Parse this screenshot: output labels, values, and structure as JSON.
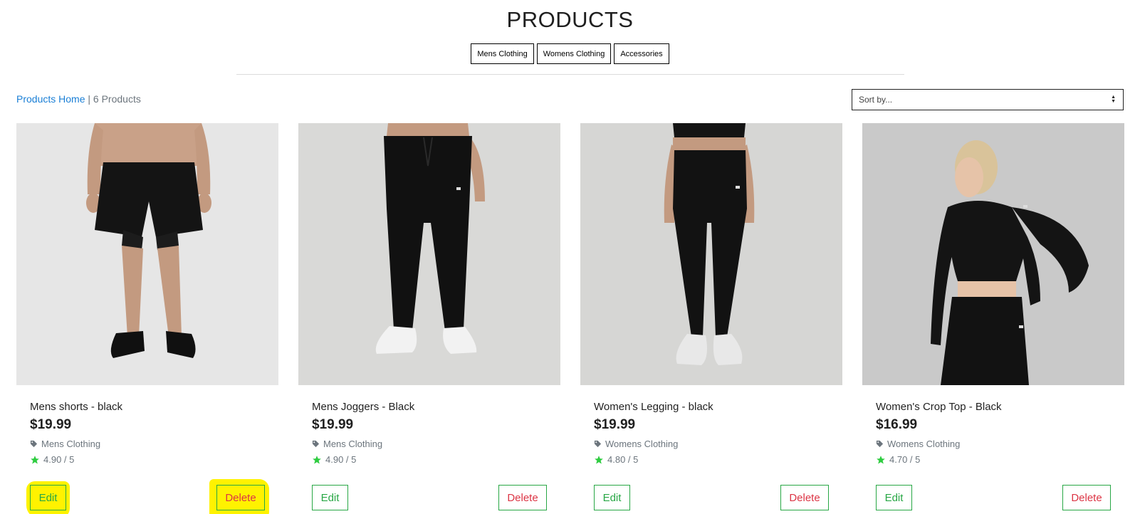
{
  "page": {
    "title": "PRODUCTS"
  },
  "category_nav": [
    {
      "label": "Mens Clothing"
    },
    {
      "label": "Womens Clothing"
    },
    {
      "label": "Accessories"
    }
  ],
  "breadcrumb": {
    "link": "Products Home",
    "separator": " | ",
    "count": "6 Products"
  },
  "sort": {
    "selected": "Sort by..."
  },
  "products": [
    {
      "name": "Mens shorts - black",
      "price": "$19.99",
      "category": "Mens Clothing",
      "rating": "4.90 / 5",
      "edit": "Edit",
      "delete": "Delete",
      "image": "mens-shorts-black",
      "highlighted": true
    },
    {
      "name": "Mens Joggers - Black",
      "price": "$19.99",
      "category": "Mens Clothing",
      "rating": "4.90 / 5",
      "edit": "Edit",
      "delete": "Delete",
      "image": "mens-joggers-black",
      "highlighted": false
    },
    {
      "name": "Women's Legging - black",
      "price": "$19.99",
      "category": "Womens Clothing",
      "rating": "4.80 / 5",
      "edit": "Edit",
      "delete": "Delete",
      "image": "womens-legging-black",
      "highlighted": false
    },
    {
      "name": "Women's Crop Top - Black",
      "price": "$16.99",
      "category": "Womens Clothing",
      "rating": "4.70 / 5",
      "edit": "Edit",
      "delete": "Delete",
      "image": "womens-crop-top-black",
      "highlighted": false
    }
  ],
  "colors": {
    "link": "#1a7fd6",
    "edit": "#28a745",
    "delete": "#dc3545",
    "star": "#2ecc40",
    "highlight": "#fff200"
  }
}
